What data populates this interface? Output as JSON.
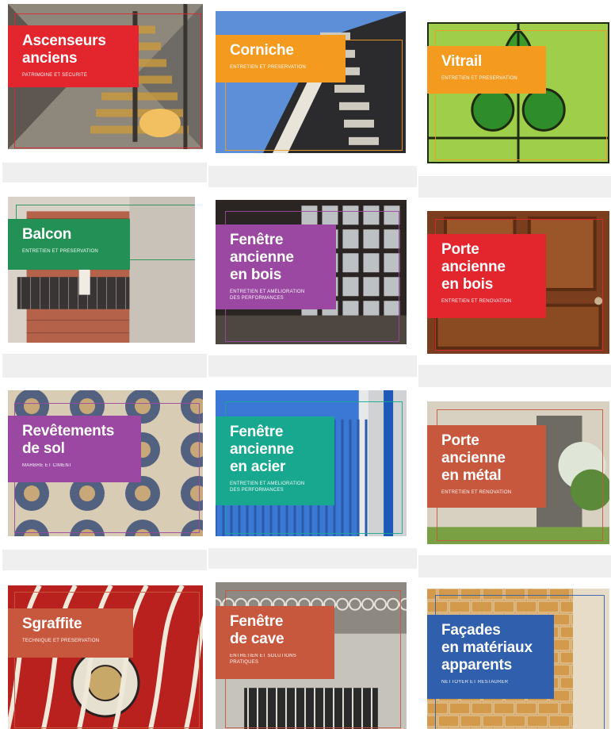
{
  "cards": [
    {
      "title": "Ascenseurs\nanciens",
      "subtitle": "Patrimoine et sécurité",
      "color": "#e3262d",
      "scene": "elevator"
    },
    {
      "title": "Corniche",
      "subtitle": "Entretien et préservation",
      "color": "#f39a1f",
      "scene": "cornice"
    },
    {
      "title": "Vitrail",
      "subtitle": "Entretien et préservation",
      "color": "#f39a1f",
      "scene": "stained-glass"
    },
    {
      "title": "Balcon",
      "subtitle": "Entretien et préservation",
      "color": "#239155",
      "scene": "balcony"
    },
    {
      "title": "Fenêtre\nancienne\nen bois",
      "subtitle": "Entretien et amélioration\ndes performances",
      "color": "#9a48a1",
      "scene": "wood-window"
    },
    {
      "title": "Porte\nancienne\nen bois",
      "subtitle": "Entretien et rénovation",
      "color": "#e3262d",
      "scene": "wood-door"
    },
    {
      "title": "Revêtements\nde sol",
      "subtitle": "Marbre et ciment",
      "color": "#9a48a1",
      "scene": "floor-tiles"
    },
    {
      "title": "Fenêtre\nancienne\nen acier",
      "subtitle": "Entretien et amélioration\ndes performances",
      "color": "#17a88f",
      "scene": "steel-window"
    },
    {
      "title": "Porte\nancienne\nen métal",
      "subtitle": "Entretien et rénovation",
      "color": "#c8583d",
      "scene": "metal-door"
    },
    {
      "title": "Sgraffite",
      "subtitle": "Technique et préservation",
      "color": "#c8583d",
      "scene": "sgraffito"
    },
    {
      "title": "Fenêtre\nde cave",
      "subtitle": "Entretien et solutions\npratiques",
      "color": "#c8583d",
      "scene": "cellar-window"
    },
    {
      "title": "Façades\nen matériaux\napparents",
      "subtitle": "Nettoyer et restaurer",
      "color": "#2f5fad",
      "scene": "brick-facade"
    }
  ]
}
